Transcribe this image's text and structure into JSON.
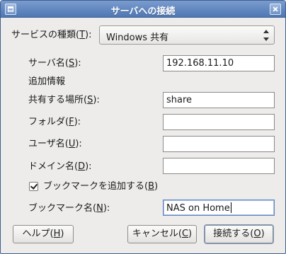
{
  "window": {
    "title": "サーバへの接続"
  },
  "service": {
    "label_prefix": "サービスの種類(",
    "label_key": "T",
    "label_suffix": "):",
    "selected": "Windows 共有"
  },
  "form": {
    "server_label_prefix": "サーバ名(",
    "server_label_key": "S",
    "server_label_suffix": "):",
    "server_value": "192.168.11.10",
    "extra_heading": "追加情報",
    "share_label_prefix": "共有する場所(",
    "share_label_key": "S",
    "share_label_suffix": "):",
    "share_value": "share",
    "folder_label_prefix": "フォルダ(",
    "folder_label_key": "F",
    "folder_label_suffix": "):",
    "folder_value": "",
    "user_label_prefix": "ユーザ名(",
    "user_label_key": "U",
    "user_label_suffix": "):",
    "user_value": "",
    "domain_label_prefix": "ドメイン名(",
    "domain_label_key": "D",
    "domain_label_suffix": "):",
    "domain_value": "",
    "bookmark_checkbox_prefix": "ブックマークを追加する(",
    "bookmark_checkbox_key": "B",
    "bookmark_checkbox_suffix": ")",
    "bookmark_checked": true,
    "bookmark_name_label_prefix": "ブックマーク名(",
    "bookmark_name_label_key": "N",
    "bookmark_name_label_suffix": "):",
    "bookmark_name_value": "NAS on Home"
  },
  "buttons": {
    "help_prefix": "ヘルプ(",
    "help_key": "H",
    "help_suffix": ")",
    "cancel_prefix": "キャンセル(",
    "cancel_key": "C",
    "cancel_suffix": ")",
    "connect_prefix": "接続する(",
    "connect_key": "O",
    "connect_suffix": ")"
  }
}
